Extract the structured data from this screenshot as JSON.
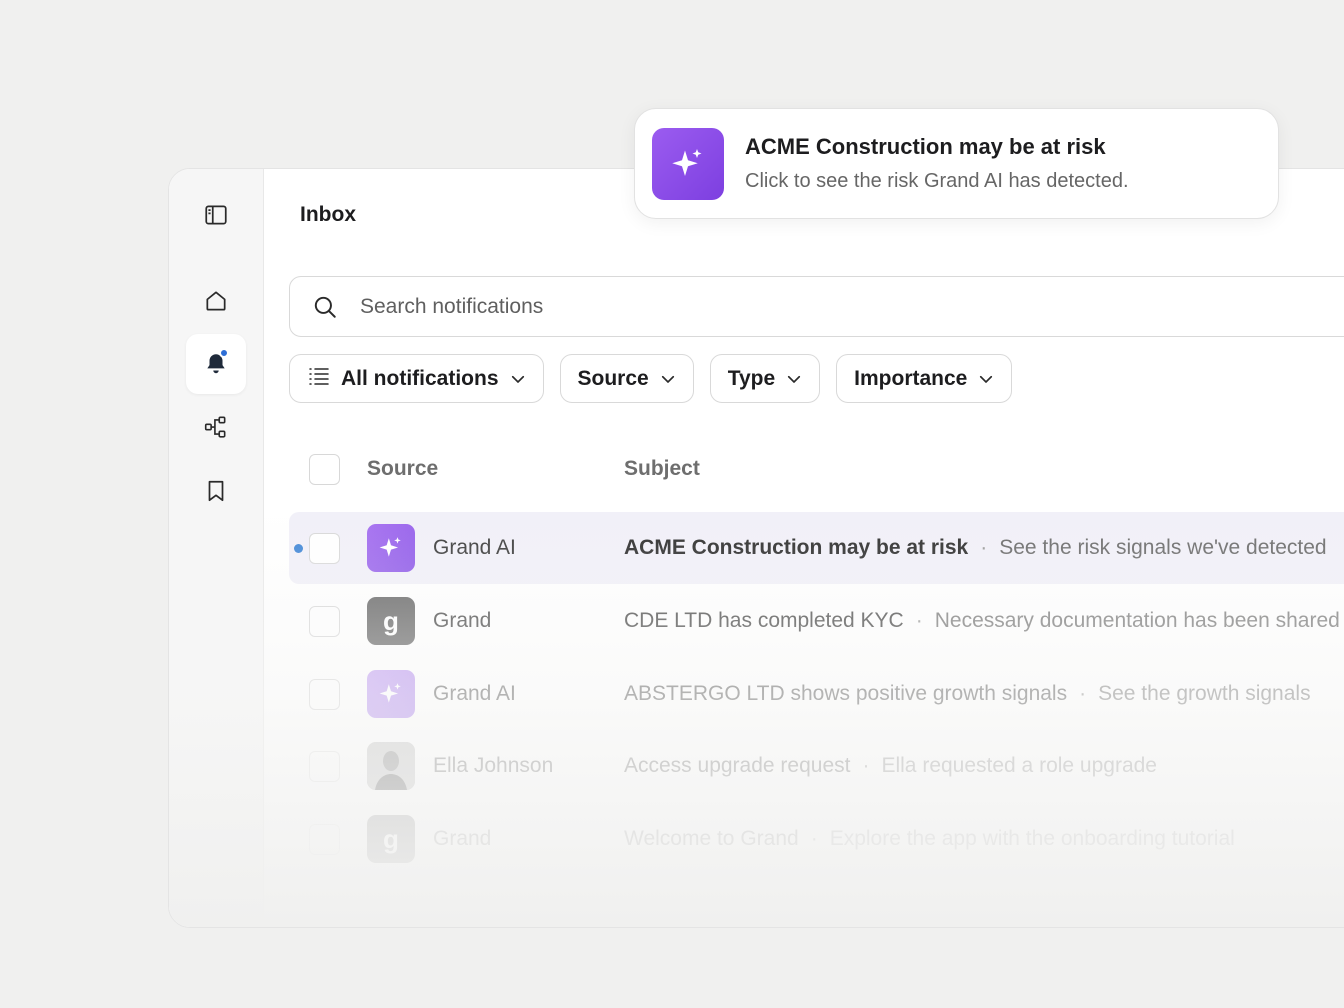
{
  "header": {
    "title": "Inbox"
  },
  "search": {
    "placeholder": "Search notifications"
  },
  "filters": [
    {
      "label": "All notifications",
      "icon": "list-icon"
    },
    {
      "label": "Source"
    },
    {
      "label": "Type"
    },
    {
      "label": "Importance"
    }
  ],
  "table": {
    "columns": {
      "source": "Source",
      "subject": "Subject"
    },
    "rows": [
      {
        "source": "Grand AI",
        "avatar": "sparkle-icon",
        "subject": "ACME Construction may be at risk",
        "preview": "See the risk signals we've detected",
        "unread": true
      },
      {
        "source": "Grand",
        "avatar": "grand-logo",
        "avatar_letter": "g",
        "subject": "CDE LTD has completed KYC",
        "preview": "Necessary documentation has been shared"
      },
      {
        "source": "Grand AI",
        "avatar": "sparkle-icon",
        "subject": "ABSTERGO LTD shows positive growth signals",
        "preview": "See the growth signals"
      },
      {
        "source": "Ella Johnson",
        "avatar": "person-photo",
        "subject": "Access upgrade request",
        "preview": "Ella requested a role upgrade"
      },
      {
        "source": "Grand",
        "avatar": "grand-logo",
        "avatar_letter": "g",
        "subject": "Welcome to Grand",
        "preview": "Explore the app with the onboarding tutorial"
      }
    ],
    "separator": "·"
  },
  "toast": {
    "title": "ACME Construction may be at risk",
    "body": "Click to see the risk Grand AI has detected."
  },
  "colors": {
    "ai_purple": "#8b55e8",
    "unread_blue": "#3f86d6",
    "notif_dot": "#2f6fd6"
  }
}
